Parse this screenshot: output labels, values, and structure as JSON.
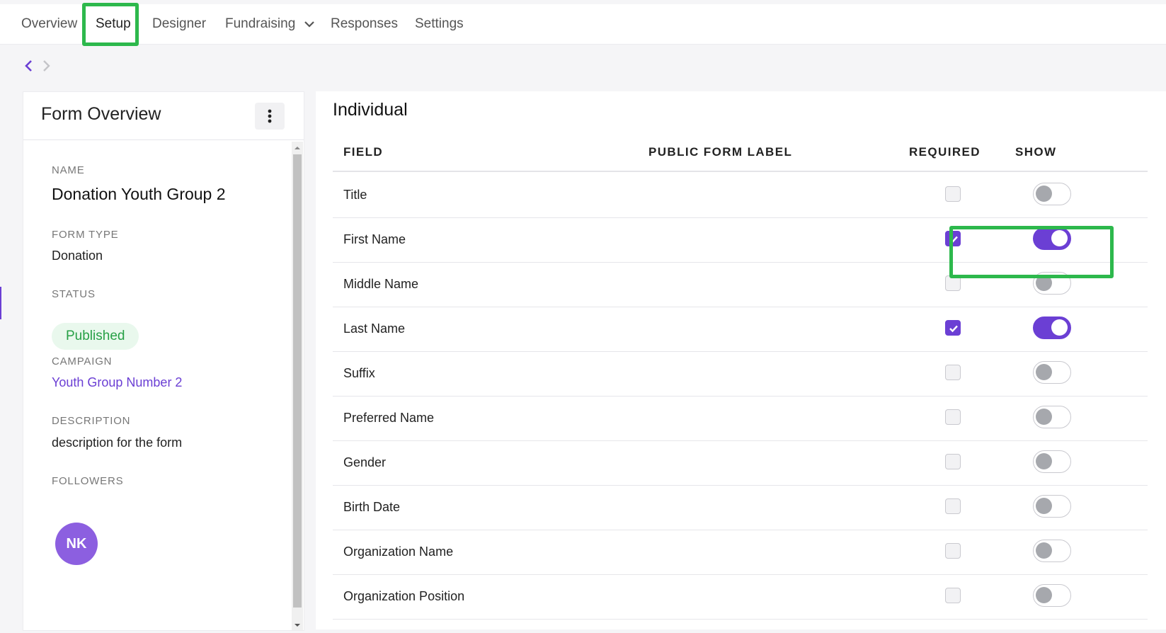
{
  "nav": {
    "tabs": [
      {
        "label": "Overview"
      },
      {
        "label": "Setup"
      },
      {
        "label": "Designer"
      },
      {
        "label": "Fundraising"
      },
      {
        "label": "Responses"
      },
      {
        "label": "Settings"
      }
    ],
    "active_tab": "Setup"
  },
  "history": {
    "back_icon": "chevron-left-icon",
    "forward_icon": "chevron-right-icon"
  },
  "form_overview": {
    "title": "Form Overview",
    "name_label": "NAME",
    "name": "Donation Youth Group 2",
    "form_type_label": "FORM TYPE",
    "form_type": "Donation",
    "status_label": "STATUS",
    "status": "Published",
    "campaign_label": "CAMPAIGN",
    "campaign": "Youth Group Number 2",
    "description_label": "DESCRIPTION",
    "description": "description for the form",
    "followers_label": "FOLLOWERS",
    "followers": [
      {
        "initials": "NK"
      }
    ]
  },
  "individual": {
    "title": "Individual",
    "columns": {
      "field": "FIELD",
      "public_label": "PUBLIC FORM LABEL",
      "required": "REQUIRED",
      "show": "SHOW"
    },
    "rows": [
      {
        "field": "Title",
        "required": false,
        "show": false
      },
      {
        "field": "First Name",
        "required": true,
        "show": true
      },
      {
        "field": "Middle Name",
        "required": false,
        "show": false
      },
      {
        "field": "Last Name",
        "required": true,
        "show": true
      },
      {
        "field": "Suffix",
        "required": false,
        "show": false
      },
      {
        "field": "Preferred Name",
        "required": false,
        "show": false
      },
      {
        "field": "Gender",
        "required": false,
        "show": false
      },
      {
        "field": "Birth Date",
        "required": false,
        "show": false
      },
      {
        "field": "Organization Name",
        "required": false,
        "show": false
      },
      {
        "field": "Organization Position",
        "required": false,
        "show": false
      }
    ]
  },
  "colors": {
    "accent": "#6b3fd4",
    "highlight": "#2db84c",
    "published": "#27a046"
  }
}
